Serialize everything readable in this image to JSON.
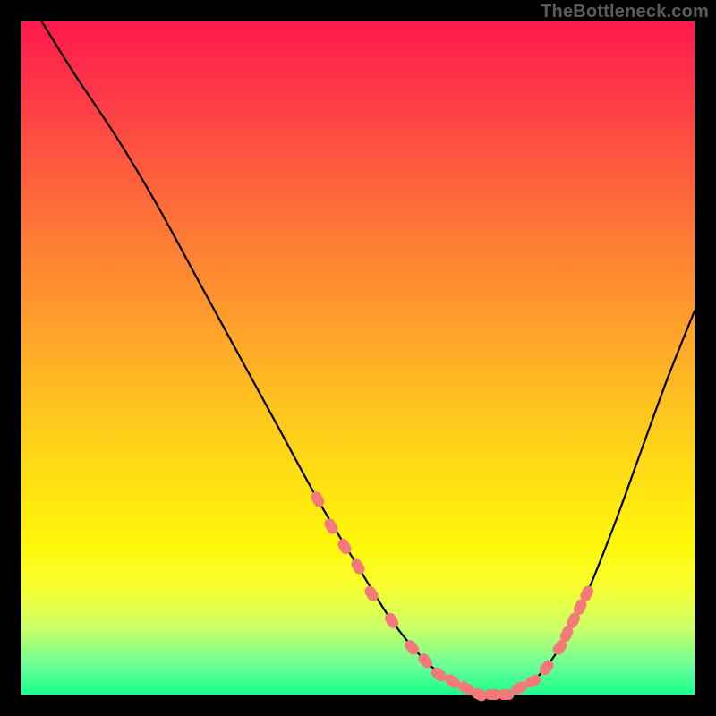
{
  "attribution": "TheBottleneck.com",
  "colors": {
    "curve": "#000000",
    "marker": "#f47a7a",
    "background_top": "#ff1a4d",
    "background_bottom": "#1aff8c"
  },
  "chart_data": {
    "type": "line",
    "title": "",
    "xlabel": "",
    "ylabel": "",
    "xlim": [
      0,
      100
    ],
    "ylim": [
      0,
      100
    ],
    "note": "y = bottleneck percentage (100 at top, 0 at bottom). x = relative component performance index.",
    "curve": {
      "x": [
        3,
        8,
        14,
        20,
        26,
        32,
        38,
        44,
        50,
        55,
        60,
        64,
        68,
        72,
        76,
        80,
        84,
        88,
        92,
        96,
        100
      ],
      "y": [
        100,
        92,
        83,
        73,
        62,
        51,
        40,
        29,
        19,
        11,
        5,
        2,
        0,
        0,
        2,
        7,
        15,
        25,
        36,
        47,
        57
      ]
    },
    "markers": {
      "comment": "salmon pill-shaped markers near the curve trough",
      "x": [
        44,
        46,
        48,
        50,
        52,
        55,
        58,
        60,
        62,
        64,
        66,
        68,
        70,
        72,
        74,
        76,
        78,
        80,
        81,
        82,
        83,
        84
      ],
      "y": [
        29,
        25,
        22,
        19,
        15,
        11,
        7,
        5,
        3,
        2,
        1,
        0,
        0,
        0,
        1,
        2,
        4,
        7,
        9,
        11,
        13,
        15
      ]
    }
  }
}
